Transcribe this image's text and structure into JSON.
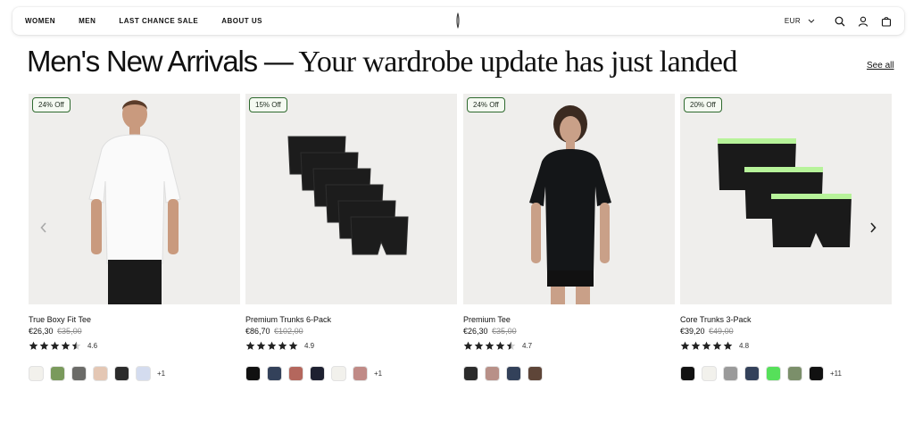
{
  "nav": {
    "items": [
      "WOMEN",
      "MEN",
      "LAST CHANCE SALE",
      "ABOUT US"
    ],
    "currency": "EUR"
  },
  "heading": {
    "bold": "Men's New Arrivals —",
    "serif": " Your wardrobe update has just landed",
    "see_all": "See all"
  },
  "products": [
    {
      "badge": "24% Off",
      "name": "True Boxy Fit Tee",
      "price": "€26,30",
      "old_price": "€35,00",
      "rating": "4.6",
      "stars": 4.5,
      "swatch_colors": [
        "#f2f1ec",
        "#7a9a5c",
        "#6b6b68",
        "#e4c7b4",
        "#2b2b2b",
        "#d4dcef"
      ],
      "more": "+1",
      "image": "white-tee-model"
    },
    {
      "badge": "15% Off",
      "name": "Premium Trunks 6-Pack",
      "price": "€86,70",
      "old_price": "€102,00",
      "rating": "4.9",
      "stars": 5,
      "swatch_colors": [
        "#111111",
        "#33415a",
        "#b4675d",
        "#1d2030",
        "#f2f1ec",
        "#c08a86"
      ],
      "more": "+1",
      "image": "black-trunks-stack"
    },
    {
      "badge": "24% Off",
      "name": "Premium Tee",
      "price": "€26,30",
      "old_price": "€35,00",
      "rating": "4.7",
      "stars": 4.5,
      "swatch_colors": [
        "#2b2b2b",
        "#b89088",
        "#33415a",
        "#5e4538"
      ],
      "more": "",
      "image": "black-tee-model"
    },
    {
      "badge": "20% Off",
      "name": "Core Trunks 3-Pack",
      "price": "€39,20",
      "old_price": "€49,00",
      "rating": "4.8",
      "stars": 5,
      "swatch_colors": [
        "#111111",
        "#f2f1ec",
        "#9a9a9a",
        "#33415a",
        "#56e05a",
        "#7b8f6a",
        "#111111"
      ],
      "more": "+11",
      "image": "black-trunks-3pack"
    }
  ],
  "colors": {
    "badge_border": "#2f6a2f",
    "image_bg": "#efeeec",
    "accent_green": "#b7f39a"
  }
}
